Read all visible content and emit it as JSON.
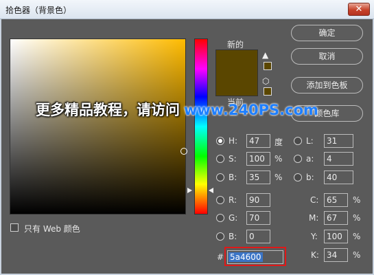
{
  "window": {
    "title": "拾色器（背景色）",
    "close_glyph": "✕"
  },
  "preview": {
    "new_label": "新的",
    "current_label": "当前",
    "new_color": "#5a4600"
  },
  "buttons": {
    "ok": "确定",
    "cancel": "取消",
    "add_to_swatches": "添加到色板",
    "color_libraries": "颜色库"
  },
  "watermark": {
    "text": "更多精品教程，请访问",
    "url": "www.240PS.com"
  },
  "hsb": [
    {
      "label": "H:",
      "value": "47",
      "unit": "度",
      "selected": true
    },
    {
      "label": "S:",
      "value": "100",
      "unit": "%",
      "selected": false
    },
    {
      "label": "B:",
      "value": "35",
      "unit": "%",
      "selected": false
    }
  ],
  "lab": [
    {
      "label": "L:",
      "value": "31"
    },
    {
      "label": "a:",
      "value": "4"
    },
    {
      "label": "b:",
      "value": "40"
    }
  ],
  "rgb": [
    {
      "label": "R:",
      "value": "90"
    },
    {
      "label": "G:",
      "value": "70"
    },
    {
      "label": "B:",
      "value": "0"
    }
  ],
  "cmyk": [
    {
      "label": "C:",
      "value": "65",
      "unit": "%"
    },
    {
      "label": "M:",
      "value": "67",
      "unit": "%"
    },
    {
      "label": "Y:",
      "value": "100",
      "unit": "%"
    },
    {
      "label": "K:",
      "value": "34",
      "unit": "%"
    }
  ],
  "hex": {
    "prefix": "#",
    "value": "5a4600"
  },
  "web_only": {
    "label": "只有 Web 颜色",
    "checked": false
  },
  "icons": {
    "warning": "gamut-warning-icon",
    "cube": "web-safe-cube-icon"
  }
}
